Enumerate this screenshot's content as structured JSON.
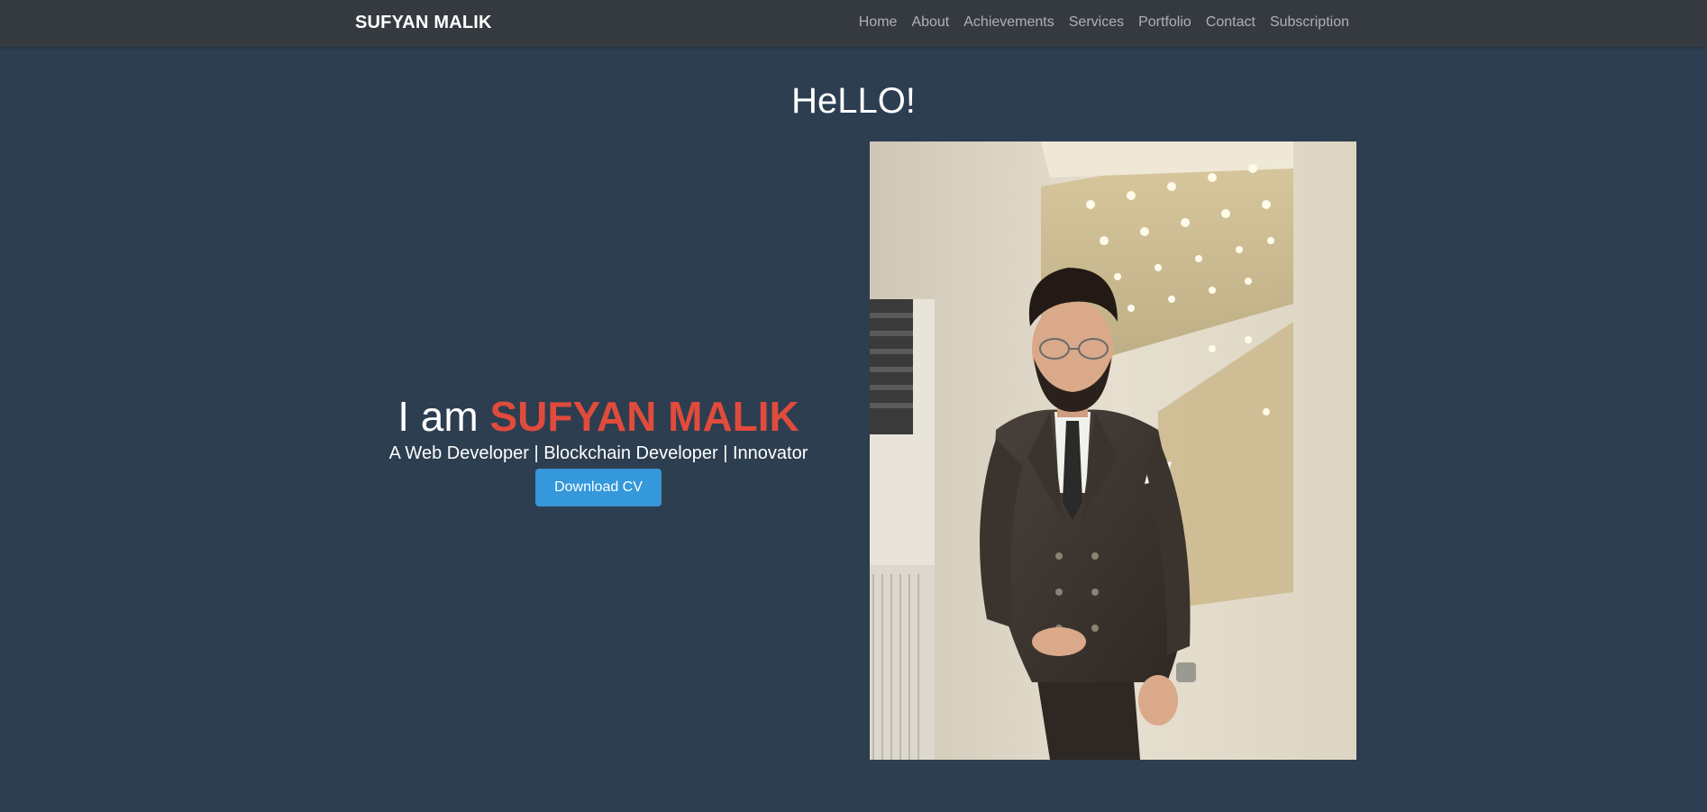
{
  "navbar": {
    "brand": "SUFYAN MALIK",
    "links": [
      {
        "label": "Home"
      },
      {
        "label": "About"
      },
      {
        "label": "Achievements"
      },
      {
        "label": "Services"
      },
      {
        "label": "Portfolio"
      },
      {
        "label": "Contact"
      },
      {
        "label": "Subscription"
      }
    ]
  },
  "hero": {
    "title": "HeLLO!",
    "intro_prefix": "I am",
    "intro_name": "SUFYAN MALIK",
    "tagline": "A Web Developer | Blockchain Developer | Innovator",
    "cv_button_label": "Download CV",
    "photo_alt": "Sufyan Malik"
  },
  "colors": {
    "page_background": "#2c3e50",
    "navbar_background": "#343a40",
    "accent_name": "#e04b3c",
    "button": "#3498db"
  }
}
